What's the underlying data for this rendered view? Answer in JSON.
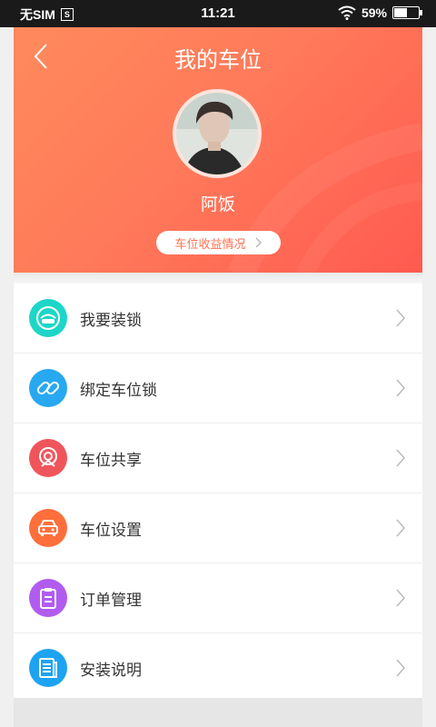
{
  "status_bar": {
    "carrier": "无SIM",
    "sim_badge": "S",
    "time": "11:21",
    "battery_percent": "59%",
    "battery_level": 0.59
  },
  "header": {
    "title": "我的车位",
    "username": "阿饭",
    "earnings_label": "车位收益情况"
  },
  "menu": [
    {
      "label": "我要装锁",
      "icon": "car-lock-icon",
      "color": "#1dd6c8"
    },
    {
      "label": "绑定车位锁",
      "icon": "link-icon",
      "color": "#28a8f0"
    },
    {
      "label": "车位共享",
      "icon": "location-pin-icon",
      "color": "#f0555c"
    },
    {
      "label": "车位设置",
      "icon": "car-icon",
      "color": "#ff6f3c"
    },
    {
      "label": "订单管理",
      "icon": "clipboard-icon",
      "color": "#b15cf0"
    },
    {
      "label": "安装说明",
      "icon": "document-icon",
      "color": "#1ea3f0"
    }
  ],
  "colors": {
    "header_start": "#ff8a5c",
    "header_end": "#ff5a50",
    "accent": "#ff7050"
  }
}
